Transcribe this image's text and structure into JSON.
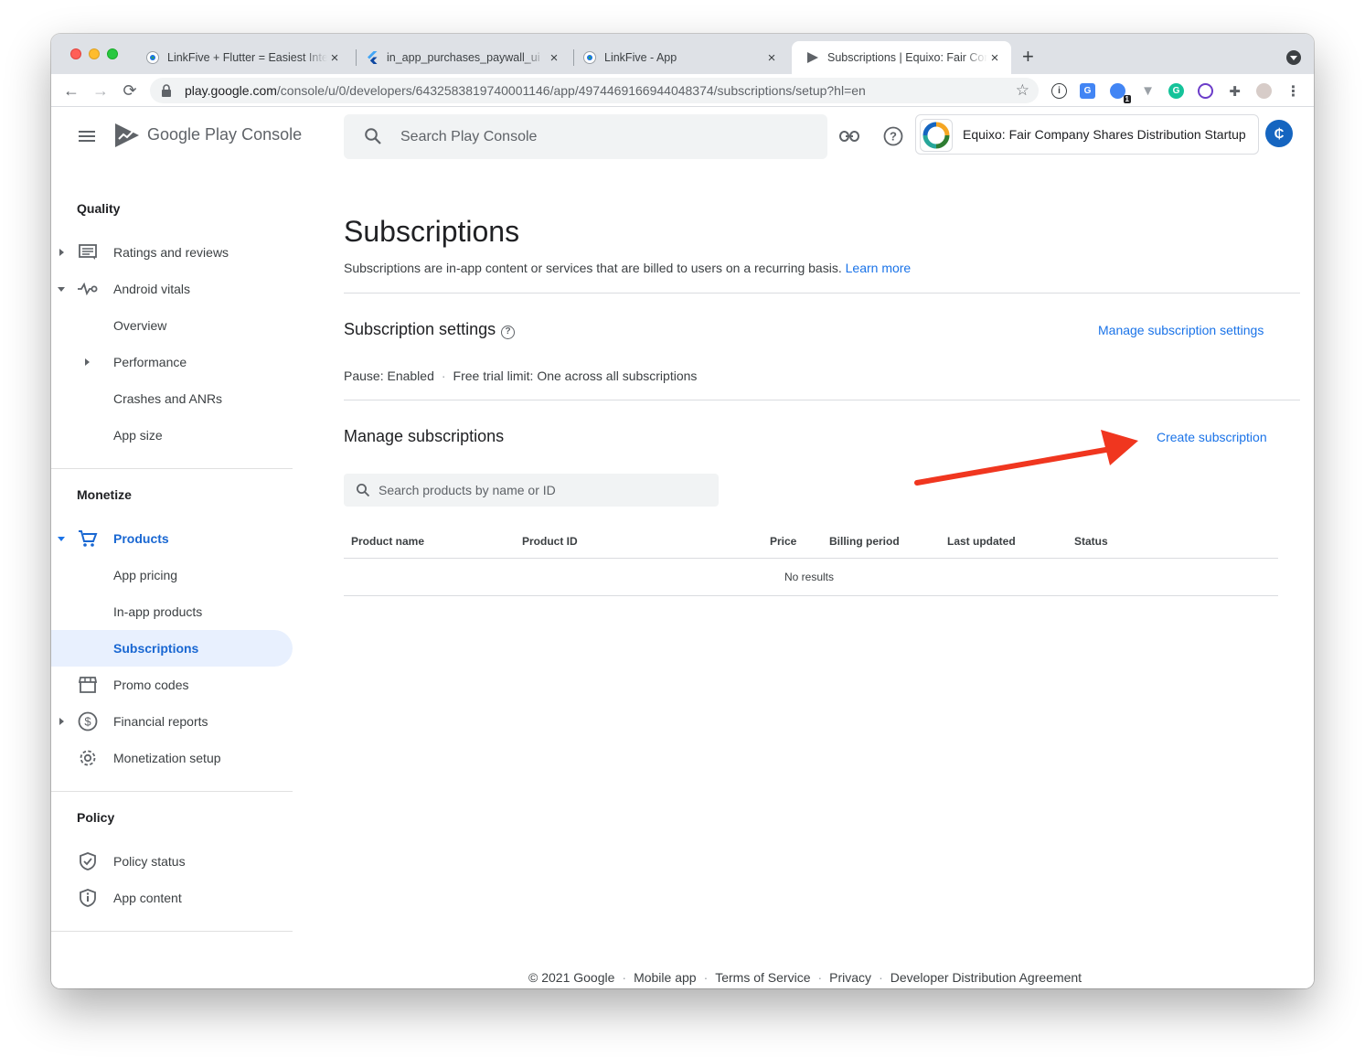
{
  "browser": {
    "tabs": [
      {
        "title": "LinkFive + Flutter = Easiest Integ"
      },
      {
        "title": "in_app_purchases_paywall_ui"
      },
      {
        "title": "LinkFive - App"
      },
      {
        "title": "Subscriptions | Equixo: Fair Com"
      }
    ],
    "url_host": "play.google.com",
    "url_path": "/console/u/0/developers/6432583819740001146/app/4974469166944048374/subscriptions/setup?hl=en",
    "extension_badge": "1"
  },
  "header": {
    "brand_google_play": "Google Play",
    "brand_console": "Console",
    "search_placeholder": "Search Play Console",
    "app_name": "Equixo: Fair Company Shares Distribution Startup",
    "account_initial": "₵"
  },
  "sidebar": {
    "quality_title": "Quality",
    "ratings": "Ratings and reviews",
    "android_vitals": "Android vitals",
    "overview": "Overview",
    "performance": "Performance",
    "crashes": "Crashes and ANRs",
    "app_size": "App size",
    "monetize_title": "Monetize",
    "products": "Products",
    "app_pricing": "App pricing",
    "inapp_products": "In-app products",
    "subscriptions": "Subscriptions",
    "promo_codes": "Promo codes",
    "financial_reports": "Financial reports",
    "monetization_setup": "Monetization setup",
    "policy_title": "Policy",
    "policy_status": "Policy status",
    "app_content": "App content"
  },
  "main": {
    "title": "Subscriptions",
    "description": "Subscriptions are in-app content or services that are billed to users on a recurring basis.",
    "learn_more": "Learn more",
    "settings_title": "Subscription settings",
    "help_glyph": "?",
    "manage_settings_link": "Manage subscription settings",
    "pause": "Pause: Enabled",
    "separator": "·",
    "free_trial": "Free trial limit: One across all subscriptions",
    "manage_title": "Manage subscriptions",
    "create_link": "Create subscription",
    "product_search_placeholder": "Search products by name or ID",
    "columns": [
      "Product name",
      "Product ID",
      "Price",
      "Billing period",
      "Last updated",
      "Status"
    ],
    "no_results": "No results"
  },
  "footer": {
    "copyright": "© 2021 Google",
    "links": [
      "Mobile app",
      "Terms of Service",
      "Privacy",
      "Developer Distribution Agreement"
    ]
  },
  "colors": {
    "accent": "#1a73e8",
    "active_bg": "#e8f0fe",
    "annotation_arrow": "#f0361f"
  }
}
